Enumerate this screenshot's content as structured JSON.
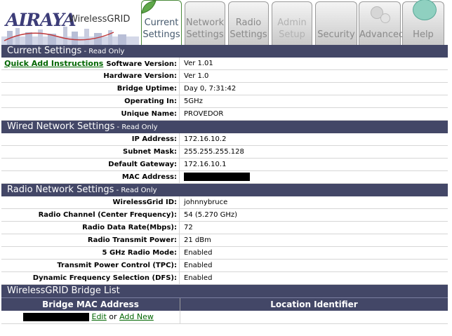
{
  "header": {
    "logo_text": "AIRAYA",
    "product_name": "WirelessGRID",
    "tabs": [
      {
        "line1": "Current",
        "line2": "Settings",
        "state": "active"
      },
      {
        "line1": "Network",
        "line2": "Settings",
        "state": "normal"
      },
      {
        "line1": "Radio",
        "line2": "Settings",
        "state": "normal"
      },
      {
        "line1": "Admin",
        "line2": "Setup",
        "state": "disabled"
      },
      {
        "line1": "",
        "line2": "Security",
        "state": "normal"
      },
      {
        "line1": "",
        "line2": "Advanced",
        "state": "normal"
      },
      {
        "line1": "",
        "line2": "Help",
        "state": "normal"
      }
    ]
  },
  "current": {
    "title": "Current Settings",
    "suffix": " - Read Only",
    "quick_add": "Quick Add Instructions",
    "rows": [
      {
        "label": "Software Version:",
        "value": "Ver 1.01"
      },
      {
        "label": "Hardware Version:",
        "value": "Ver 1.0"
      },
      {
        "label": "Bridge Uptime:",
        "value": "Day 0, 7:31:42"
      },
      {
        "label": "Operating In:",
        "value": "5GHz"
      },
      {
        "label": "Unique Name:",
        "value": "PROVEDOR"
      }
    ]
  },
  "wired": {
    "title": "Wired Network Settings",
    "suffix": " - Read Only",
    "rows": [
      {
        "label": "IP Address:",
        "value": "172.16.10.2"
      },
      {
        "label": "Subnet Mask:",
        "value": "255.255.255.128"
      },
      {
        "label": "Default Gateway:",
        "value": "172.16.10.1"
      },
      {
        "label": "MAC Address:",
        "value": ""
      }
    ]
  },
  "radio": {
    "title": "Radio Network Settings",
    "suffix": " - Read Only",
    "rows": [
      {
        "label": "WirelessGrid ID:",
        "value": "johnnybruce"
      },
      {
        "label": "Radio Channel (Center Frequency):",
        "value": "54 (5.270 GHz)"
      },
      {
        "label": "Radio Data Rate(Mbps):",
        "value": "72"
      },
      {
        "label": "Radio Transmit Power:",
        "value": "21 dBm"
      },
      {
        "label": "5 GHz Radio Mode:",
        "value": "Enabled"
      },
      {
        "label": "Transmit Power Control (TPC):",
        "value": "Enabled"
      },
      {
        "label": "Dynamic Frequency Selection (DFS):",
        "value": "Enabled"
      }
    ]
  },
  "bridge_list": {
    "title": "WirelessGRID Bridge List",
    "col1": "Bridge MAC Address",
    "col2": "Location Identifier",
    "edit": "Edit",
    "or": " or ",
    "add_new": "Add New"
  },
  "colors": {
    "section_bar": "#434767",
    "link": "#006600",
    "active_tab_border": "#4a8a3a"
  }
}
